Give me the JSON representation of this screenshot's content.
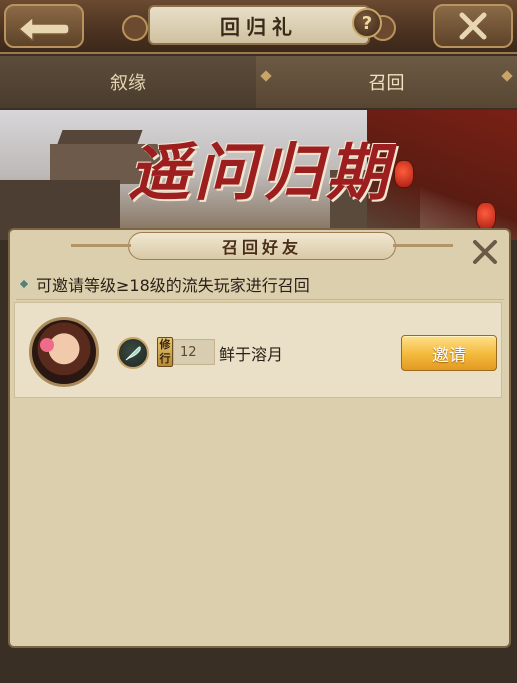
{
  "header": {
    "title": "回归礼",
    "help_glyph": "?",
    "back_icon": "back-arrow-icon",
    "close_icon": "close-icon"
  },
  "tabs": [
    {
      "label": "叙缘",
      "active": false
    },
    {
      "label": "召回",
      "active": true
    }
  ],
  "banner": {
    "title": "遥问归期"
  },
  "dialog": {
    "title": "召回好友",
    "subtitle": "可邀请等级≥18级的流失玩家进行召回",
    "friends": [
      {
        "rank_tag": "修行",
        "level": "12",
        "name": "鲜于溶月",
        "invite_label": "邀请"
      }
    ]
  },
  "colors": {
    "accent_gold": "#c8a468",
    "dialog_bg": "#dccfae",
    "invite_button": "#f3b93c",
    "banner_title": "#9c1e1f"
  }
}
